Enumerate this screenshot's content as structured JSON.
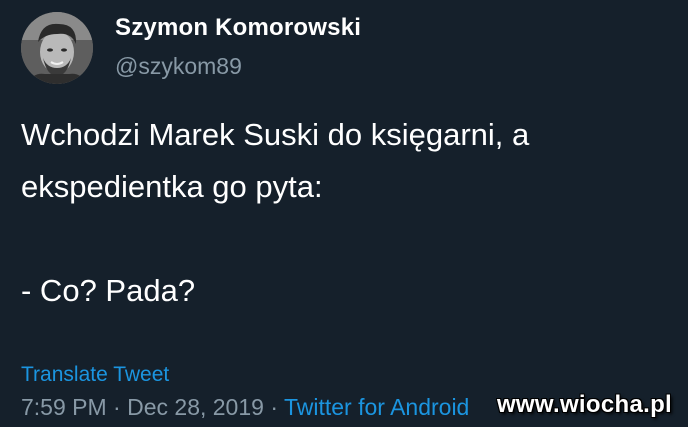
{
  "tweet": {
    "author": {
      "display_name": "Szymon Komorowski",
      "handle": "@szykom89",
      "avatar": "profile-photo"
    },
    "text_lines": [
      "Wchodzi Marek Suski do księgarni, a",
      "ekspedientka go pyta:",
      "",
      "- Co? Pada?"
    ],
    "translate_label": "Translate Tweet",
    "time": "7:59 PM",
    "separator": "·",
    "date": "Dec 28, 2019",
    "source": "Twitter for Android"
  },
  "watermark": "www.wiocha.pl",
  "colors": {
    "background": "#15202b",
    "primary_text": "#ffffff",
    "secondary_text": "#8899a6",
    "link": "#1b95e0"
  }
}
